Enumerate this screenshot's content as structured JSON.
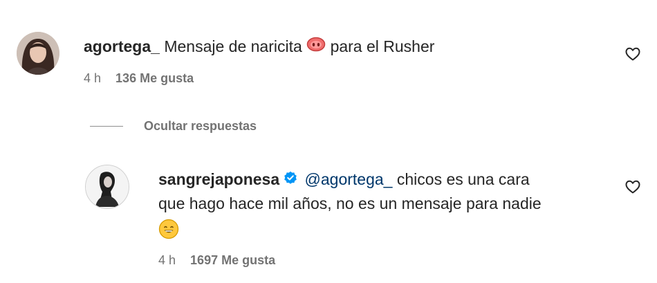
{
  "comments": [
    {
      "username": "agortega_",
      "text_before_emoji": "Mensaje de naricita",
      "emoji": "pig-nose-emoji",
      "text_after_emoji": "para el Rusher",
      "time": "4 h",
      "likes": "136 Me gusta",
      "like_icon": "heart-outline-icon"
    }
  ],
  "replies_toggle": {
    "label": "Ocultar respuestas"
  },
  "replies": [
    {
      "username": "sangrejaponesa",
      "verified_icon": "verified-badge-icon",
      "mention": "@agortega_",
      "text_line1": "chicos es una cara",
      "text_line2": "que hago hace mil años, no es un mensaje para nadie",
      "emoji": "grinning-face-emoji",
      "time": "4 h",
      "likes": "1697 Me gusta",
      "like_icon": "heart-outline-icon"
    }
  ],
  "colors": {
    "text": "#262626",
    "secondary": "#737373",
    "mention": "#00376b",
    "verified": "#0095f6"
  }
}
